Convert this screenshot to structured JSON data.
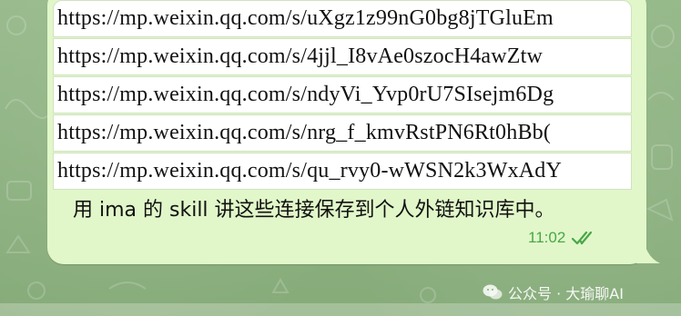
{
  "links": [
    "https://mp.weixin.qq.com/s/uXgz1z99nG0bg8jTGluEm",
    "https://mp.weixin.qq.com/s/4jjl_I8vAe0szocH4awZtw",
    "https://mp.weixin.qq.com/s/ndyVi_Yvp0rU7SIsejm6Dg",
    "https://mp.weixin.qq.com/s/nrg_f_kmvRstPN6Rt0hBb(",
    "https://mp.weixin.qq.com/s/qu_rvy0-wWSN2k3WxAdY"
  ],
  "message": {
    "text": "用 ima 的 skill 讲这些连接保存到个人外链知识库中。",
    "time": "11:02",
    "status_icon": "double-check-read-icon"
  },
  "watermark": {
    "text": "公众号 · 大瑜聊AI",
    "icon": "wechat-logo-icon"
  },
  "colors": {
    "bubble": "#e1f7c9",
    "time": "#4aa64a",
    "background": "#8fb181"
  }
}
